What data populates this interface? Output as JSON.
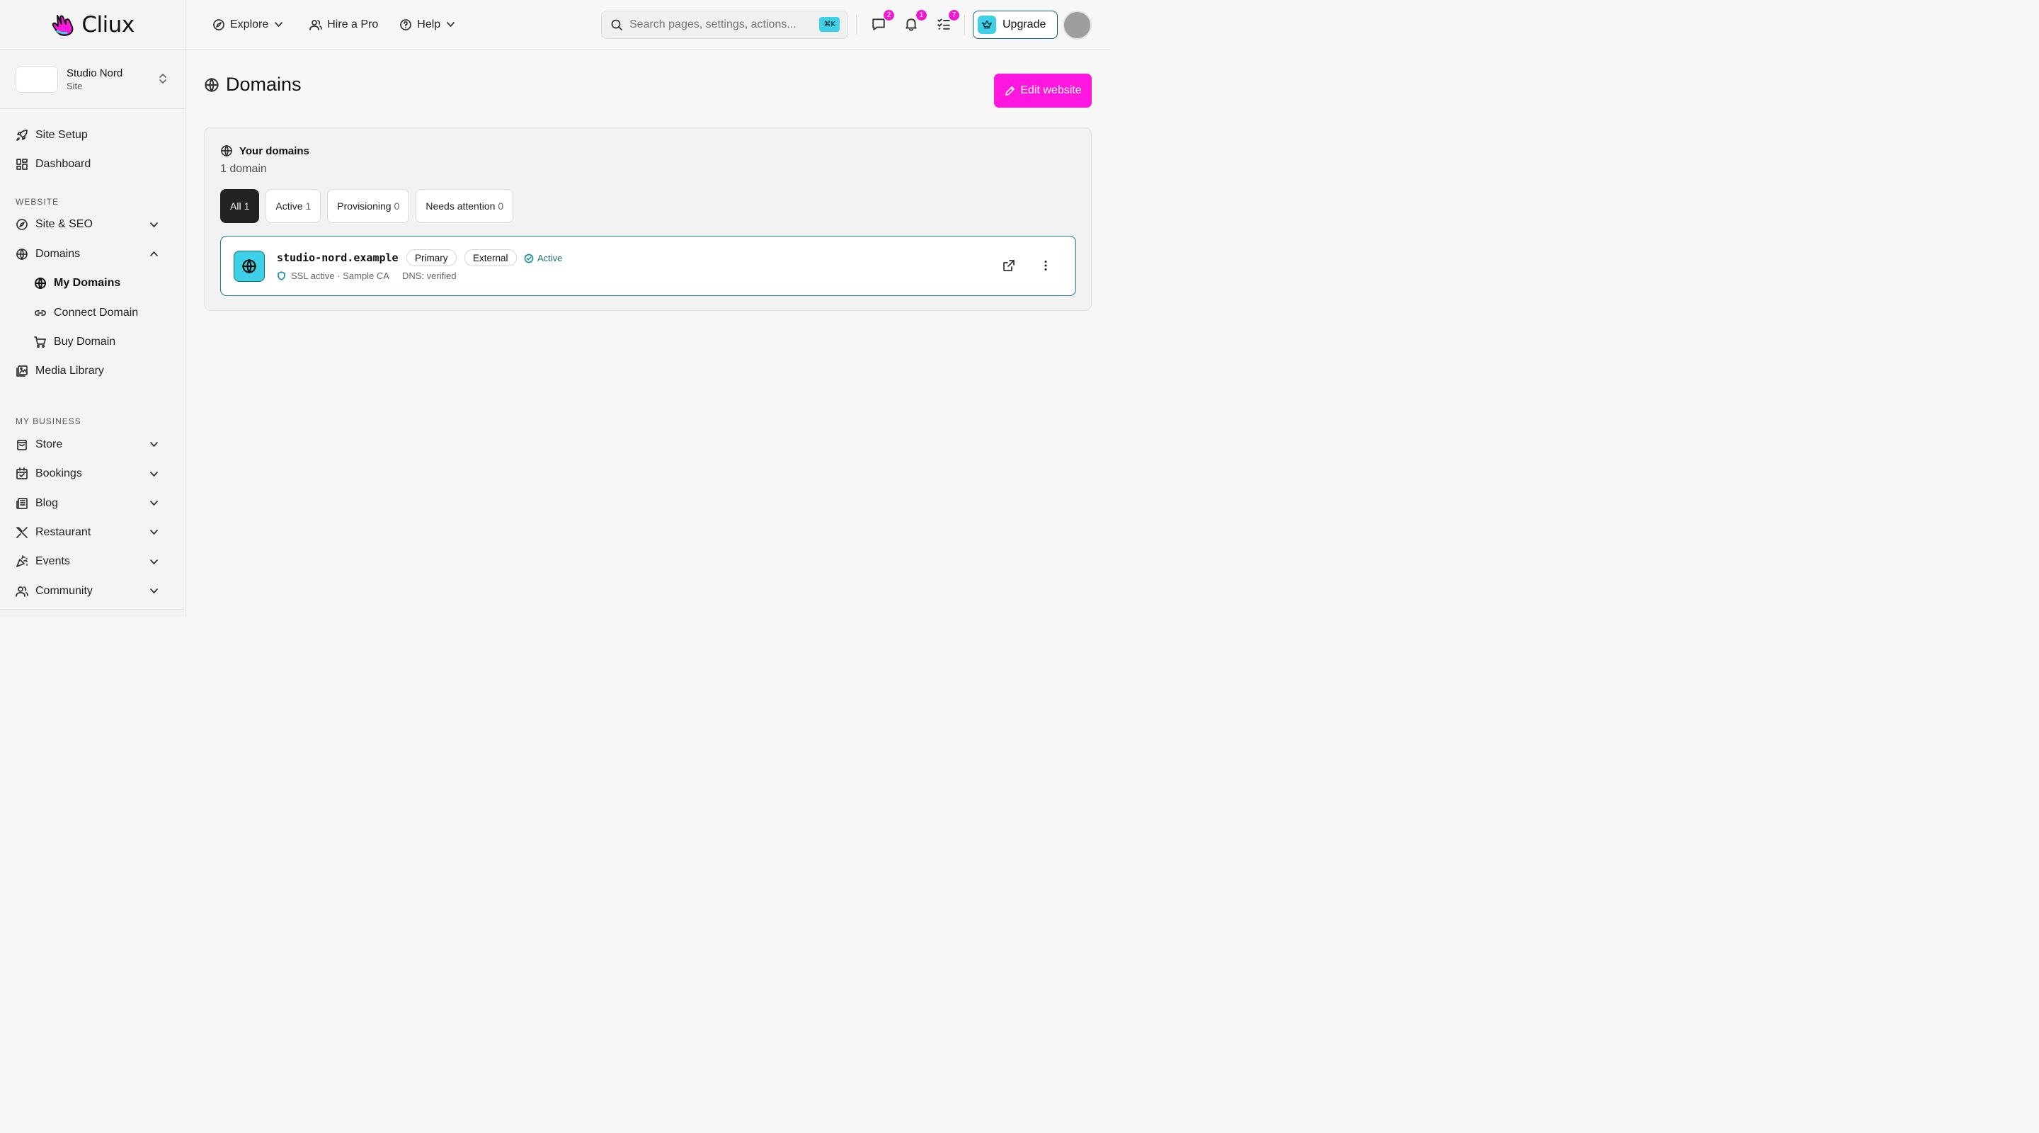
{
  "brand": {
    "name": "Cliux"
  },
  "site": {
    "name": "Studio Nord",
    "type": "Site"
  },
  "sidebar": {
    "top_items": [
      {
        "label": "Site Setup",
        "icon": "rocket-icon"
      },
      {
        "label": "Dashboard",
        "icon": "grid-icon"
      }
    ],
    "sections": {
      "website": "WEBSITE",
      "business": "MY BUSINESS"
    },
    "website_items": {
      "site_seo": "Site & SEO",
      "domains": "Domains",
      "my_domains": "My Domains",
      "connect_domain": "Connect Domain",
      "buy_domain": "Buy Domain",
      "media_library": "Media Library"
    },
    "business_items": {
      "store": "Store",
      "bookings": "Bookings",
      "blog": "Blog",
      "restaurant": "Restaurant",
      "events": "Events",
      "community": "Community"
    }
  },
  "topbar": {
    "explore": "Explore",
    "hire_pro": "Hire a Pro",
    "help": "Help",
    "search_placeholder": "Search pages, settings, actions...",
    "search_shortcut": "⌘K",
    "badges": {
      "messages": "2",
      "notifications": "1",
      "tasks": "7"
    },
    "upgrade": "Upgrade"
  },
  "main": {
    "title": "Domains",
    "edit_button": "Edit website",
    "card": {
      "title": "Your domains",
      "count": "1 domain",
      "filters": [
        {
          "label": "All",
          "count": "1"
        },
        {
          "label": "Active",
          "count": "1"
        },
        {
          "label": "Provisioning",
          "count": "0"
        },
        {
          "label": "Needs attention",
          "count": "0"
        }
      ],
      "domain": {
        "name": "studio-nord.example",
        "tag_primary": "Primary",
        "tag_external": "External",
        "status": "Active",
        "ssl": "SSL active · Sample CA",
        "dns": "DNS: verified"
      }
    }
  },
  "colors": {
    "accent_pink": "#ff17e0",
    "accent_cyan": "#3dd0e6",
    "teal_border": "#1b7d8f"
  }
}
